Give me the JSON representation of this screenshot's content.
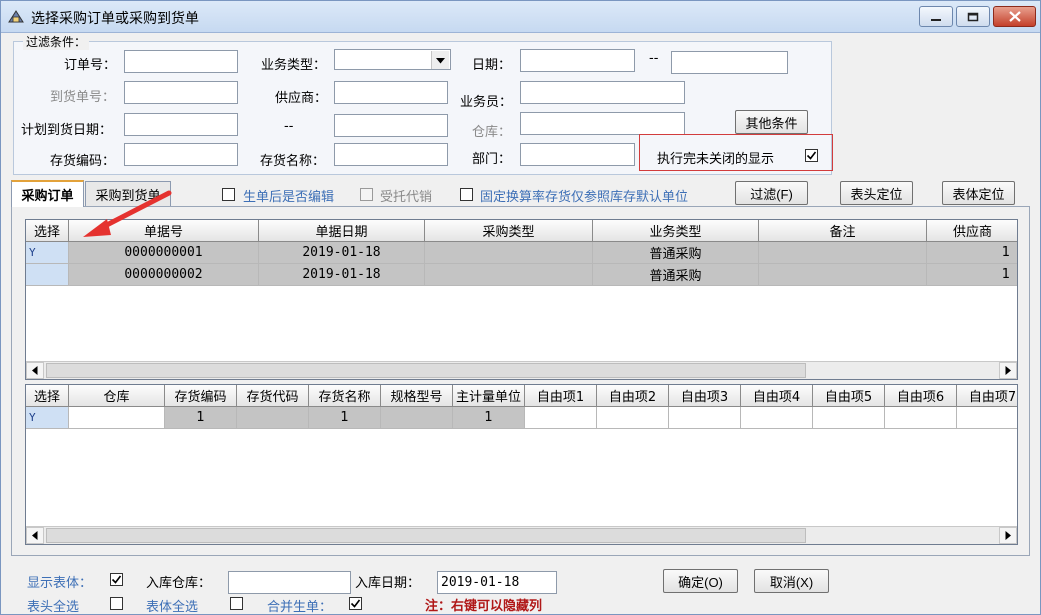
{
  "window": {
    "title": "选择采购订单或采购到货单"
  },
  "filter": {
    "legend": "过滤条件：",
    "order_no_label": "订单号：",
    "arrival_no_label": "到货单号：",
    "plan_date_label": "计划到货日期：",
    "inv_code_label": "存货编码：",
    "biz_type_label": "业务类型：",
    "supplier_label": "供应商：",
    "dash": "--",
    "inv_name_label": "存货名称：",
    "date_label": "日期：",
    "date_dash": "--",
    "clerk_label": "业务员：",
    "warehouse_label": "仓库：",
    "dept_label": "部门：",
    "other_button": "其他条件",
    "show_closed_label": "执行完未关闭的显示"
  },
  "tabs": {
    "order_tab": "采购订单",
    "arrival_tab": "采购到货单"
  },
  "options": {
    "edit_after_label": "生单后是否编辑",
    "consign_label": "受托代销",
    "fixed_rate_label": "固定换算率存货仅参照库存默认单位",
    "filter_button": "过滤(F)",
    "header_locate_button": "表头定位",
    "body_locate_button": "表体定位"
  },
  "top_grid": {
    "columns": [
      "选择",
      "单据号",
      "单据日期",
      "采购类型",
      "业务类型",
      "备注",
      "供应商"
    ],
    "rows": [
      {
        "sel": "Y",
        "doc_no": "0000000001",
        "date": "2019-01-18",
        "purchase_type": "",
        "biz_type": "普通采购",
        "remark": "",
        "supplier": "1"
      },
      {
        "sel": "",
        "doc_no": "0000000002",
        "date": "2019-01-18",
        "purchase_type": "",
        "biz_type": "普通采购",
        "remark": "",
        "supplier": "1"
      }
    ]
  },
  "bottom_grid": {
    "columns": [
      "选择",
      "仓库",
      "存货编码",
      "存货代码",
      "存货名称",
      "规格型号",
      "主计量单位",
      "自由项1",
      "自由项2",
      "自由项3",
      "自由项4",
      "自由项5",
      "自由项6",
      "自由项7"
    ],
    "rows": [
      {
        "sel": "Y",
        "warehouse": "",
        "inv_code": "1",
        "inv_alias": "",
        "inv_name": "1",
        "spec": "",
        "unit": "1"
      }
    ]
  },
  "footer": {
    "show_body_label": "显示表体：",
    "in_warehouse_label": "入库仓库：",
    "in_date_label": "入库日期：",
    "in_date_value": "2019-01-18",
    "ok_button": "确定(O)",
    "cancel_button": "取消(X)",
    "header_all_label": "表头全选",
    "body_all_label": "表体全选",
    "merge_label": "合并生单：",
    "note": "注：右键可以隐藏列"
  },
  "colors": {
    "accent_red": "#d23c3c",
    "note_red": "#b01818",
    "link_blue": "#3d6fb6"
  }
}
